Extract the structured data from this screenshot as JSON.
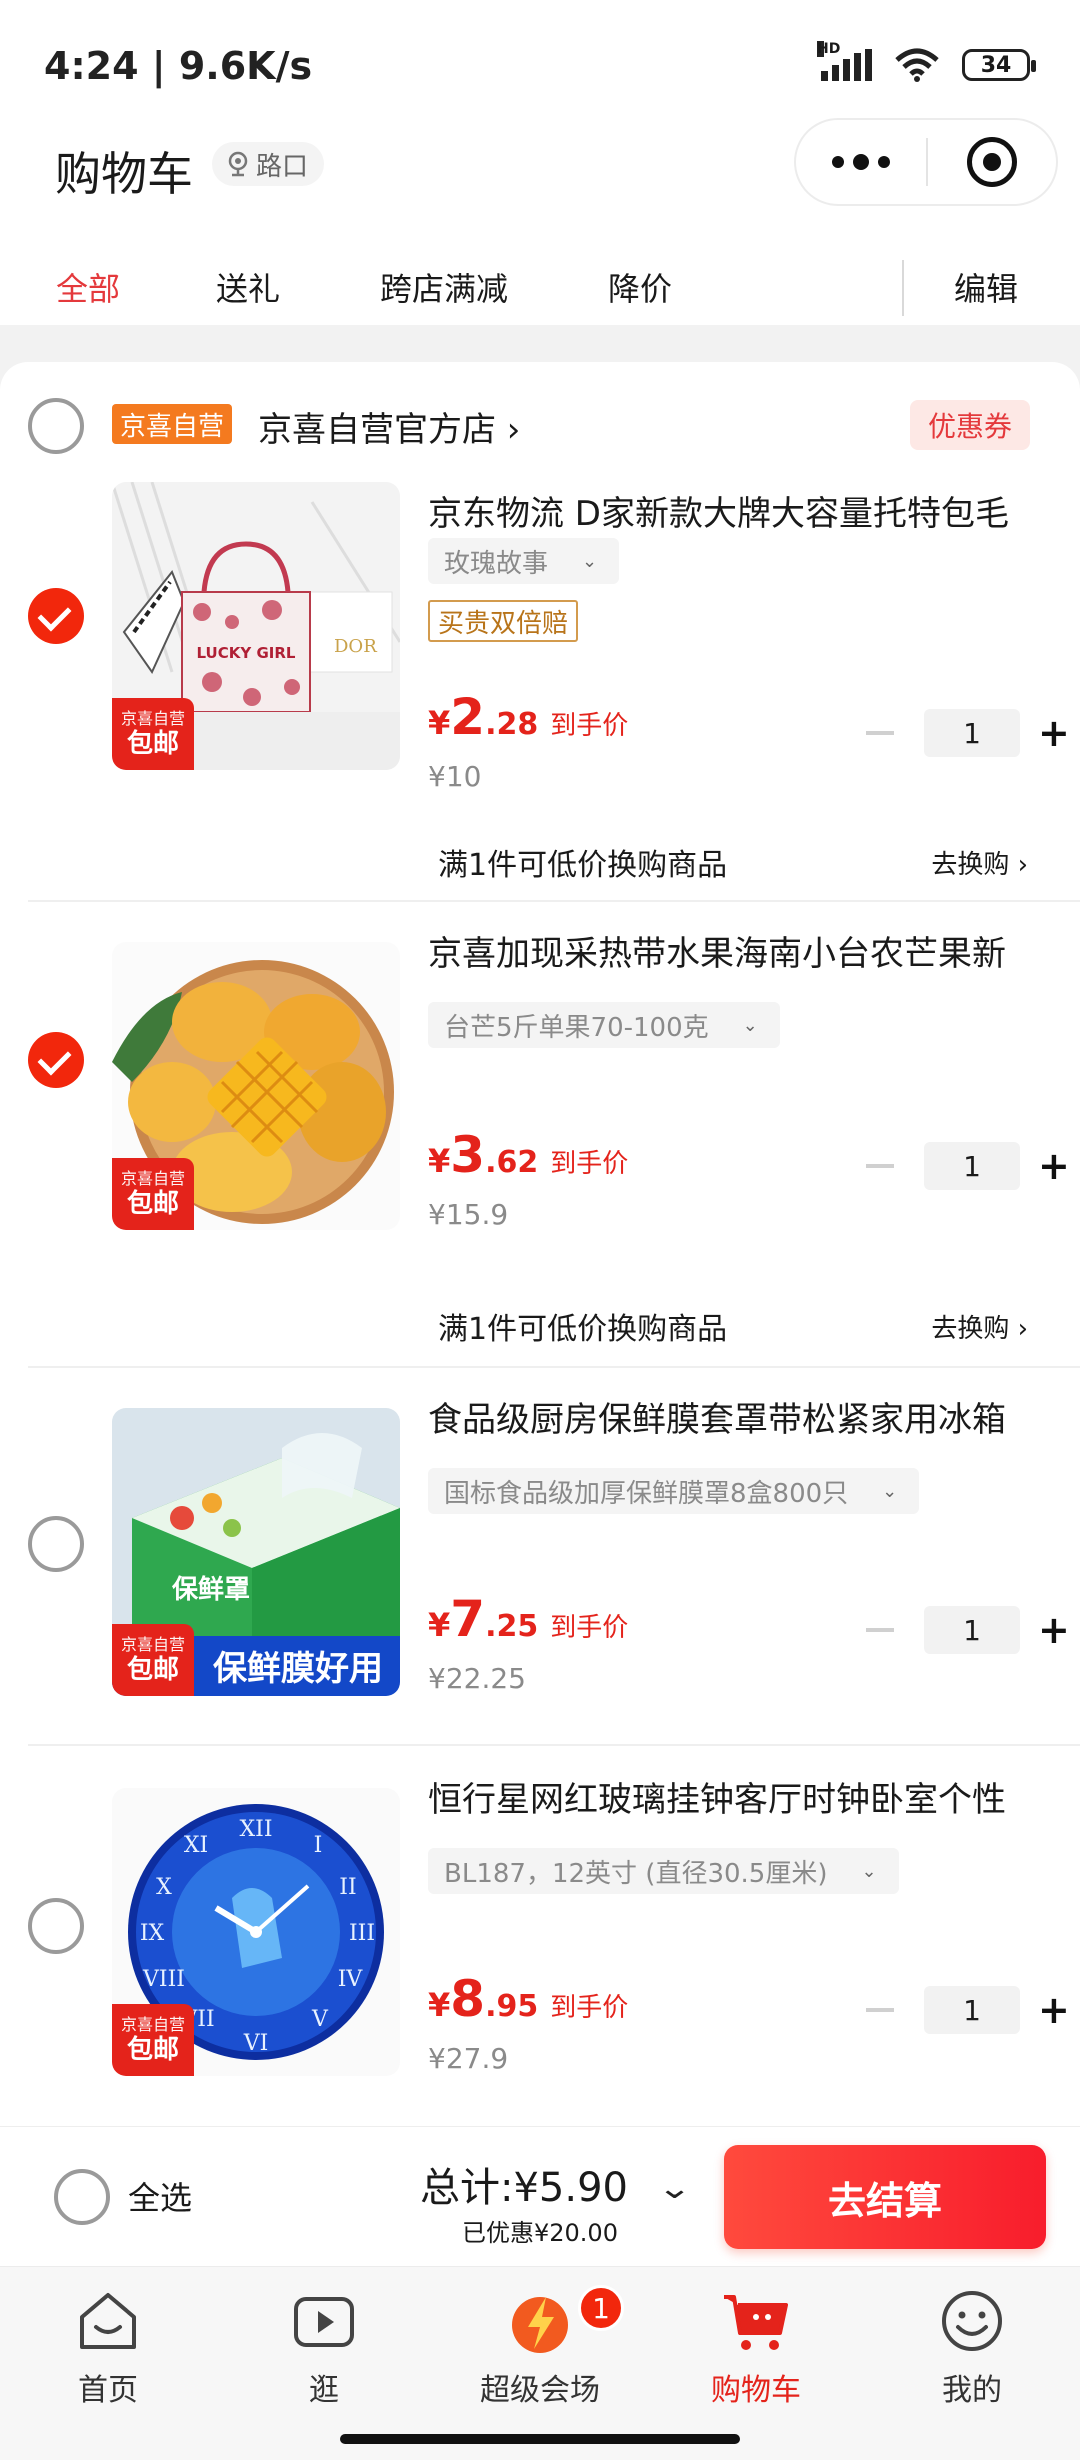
{
  "status_bar": {
    "time": "4:24 | 9.6K/s",
    "network": "HD",
    "battery": "34"
  },
  "header": {
    "title": "购物车",
    "location": "路口"
  },
  "tabs": [
    {
      "label": "全部",
      "active": true
    },
    {
      "label": "送礼",
      "active": false
    },
    {
      "label": "跨店满减",
      "active": false
    },
    {
      "label": "降价",
      "active": false
    }
  ],
  "edit_label": "编辑",
  "store": {
    "badge": "京喜自营",
    "name": "京喜自营官方店 ›",
    "coupon": "优惠券"
  },
  "thumb_badge": {
    "top": "京喜自营",
    "bottom": "包邮"
  },
  "items": [
    {
      "name": "京东物流 D家新款大牌大容量托特包毛",
      "spec": "玫瑰故事",
      "guarantee": "买贵双倍赔",
      "price_symbol": "¥",
      "price_int": "2",
      "price_dec": ".28",
      "price_tag": "到手价",
      "original": "¥10",
      "qty": "1",
      "checked": true,
      "swap_text": "满1件可低价换购商品",
      "swap_link": "去换购 ›",
      "image_text": "LUCKY GIRL"
    },
    {
      "name": "京喜加现采热带水果海南小台农芒果新",
      "spec": "台芒5斤单果70-100克",
      "price_symbol": "¥",
      "price_int": "3",
      "price_dec": ".62",
      "price_tag": "到手价",
      "original": "¥15.9",
      "qty": "1",
      "checked": true,
      "swap_text": "满1件可低价换购商品",
      "swap_link": "去换购 ›"
    },
    {
      "name": "食品级厨房保鲜膜套罩带松紧家用冰箱",
      "spec": "国标食品级加厚保鲜膜罩8盒800只",
      "price_symbol": "¥",
      "price_int": "7",
      "price_dec": ".25",
      "price_tag": "到手价",
      "original": "¥22.25",
      "qty": "1",
      "checked": false,
      "image_text": "保鲜膜好用",
      "box_text": "保鲜罩"
    },
    {
      "name": "恒行星网红玻璃挂钟客厅时钟卧室个性",
      "spec": "BL187，12英寸 (直径30.5厘米)",
      "price_symbol": "¥",
      "price_int": "8",
      "price_dec": ".95",
      "price_tag": "到手价",
      "original": "¥27.9",
      "qty": "1",
      "checked": false
    }
  ],
  "checkout": {
    "select_all": "全选",
    "total": "总计:¥5.90",
    "saved": "已优惠¥20.00",
    "button": "去结算"
  },
  "nav": [
    {
      "label": "首页",
      "icon": "home-icon"
    },
    {
      "label": "逛",
      "icon": "video-play-icon"
    },
    {
      "label": "超级会场",
      "icon": "super-venue-icon",
      "badge": "1"
    },
    {
      "label": "购物车",
      "icon": "cart-icon",
      "active": true
    },
    {
      "label": "我的",
      "icon": "smiley-face-icon"
    }
  ],
  "colors": {
    "accent": "#e4231b",
    "store_badge": "#f47a1f",
    "checkout_button": "#f81d2c"
  }
}
